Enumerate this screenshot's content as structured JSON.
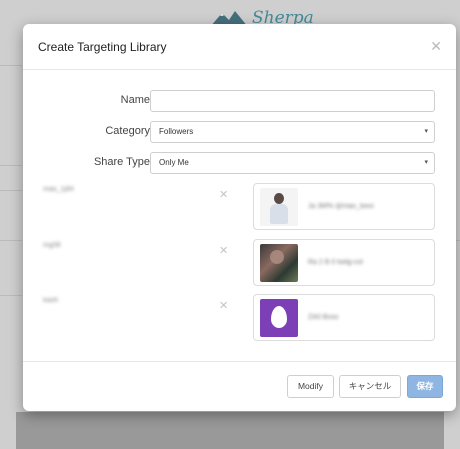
{
  "background": {
    "logo_text": "Sherpa",
    "logo_icon": "mountain-logo-icon"
  },
  "modal": {
    "title": "Create Targeting Library",
    "close_icon": "close-icon"
  },
  "form": {
    "name": {
      "label": "Name",
      "value": ""
    },
    "category": {
      "label": "Category",
      "value": "Followers"
    },
    "share_type": {
      "label": "Share Type",
      "value": "Only Me"
    }
  },
  "members": [
    {
      "id": "mao_1j84",
      "name": "Ja 3M% @mao_twxx",
      "avatar": "person-avatar"
    },
    {
      "id": "mg08",
      "name": "Ra 2 B 0 twitg-col",
      "avatar": "photo-avatar"
    },
    {
      "id": "kaoh",
      "name": "ZA0 Bxxo",
      "avatar": "egg-avatar"
    }
  ],
  "footer": {
    "modify_label": "Modify",
    "cancel_label": "キャンセル",
    "save_label": "保存"
  },
  "colors": {
    "primary_button": "#8fb6e2",
    "egg_avatar_bg": "#7d3fb5",
    "logo": "#2d7f8f"
  }
}
